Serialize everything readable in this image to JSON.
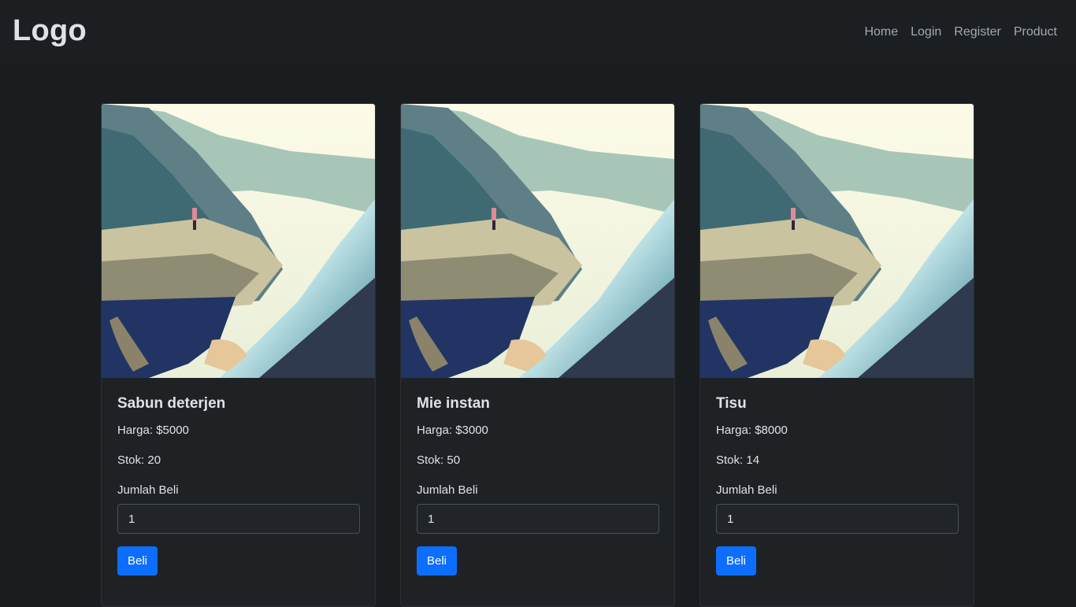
{
  "navbar": {
    "brand": "Logo",
    "links": [
      "Home",
      "Login",
      "Register",
      "Product"
    ]
  },
  "products": [
    {
      "name": "Sabun deterjen",
      "price": "Harga: $5000",
      "stock": "Stok: 20",
      "qty_label": "Jumlah Beli",
      "qty_value": "1",
      "buy_label": "Beli"
    },
    {
      "name": "Mie instan",
      "price": "Harga: $3000",
      "stock": "Stok: 50",
      "qty_label": "Jumlah Beli",
      "qty_value": "1",
      "buy_label": "Beli"
    },
    {
      "name": "Tisu",
      "price": "Harga: $8000",
      "stock": "Stok: 14",
      "qty_label": "Jumlah Beli",
      "qty_value": "1",
      "buy_label": "Beli"
    }
  ],
  "colors": {
    "background": "#1a1d20",
    "navbar": "#1c1f22",
    "card": "#1f2225",
    "primary": "#0d6efd"
  }
}
